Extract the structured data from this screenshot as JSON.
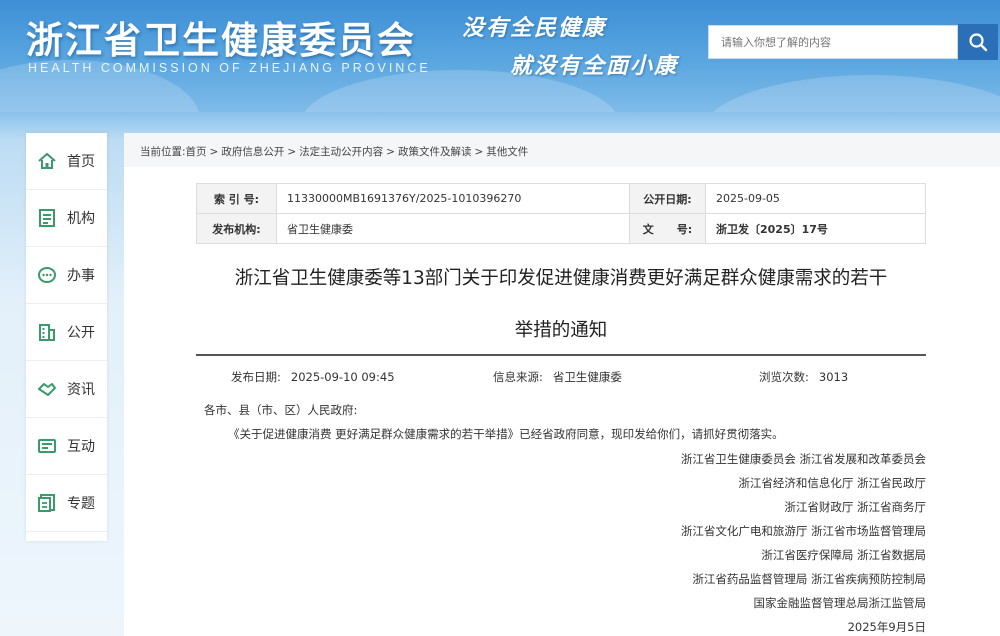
{
  "header": {
    "site_title": "浙江省卫生健康委员会",
    "site_subtitle": "HEALTH COMMISSION OF ZHEJIANG PROVINCE",
    "slogan_line1": "没有全民健康",
    "slogan_line2": "就没有全面小康",
    "search_placeholder": "请输入你想了解的内容",
    "search_icon": "search-icon"
  },
  "sidebar": {
    "items": [
      {
        "label": "首页",
        "icon": "home-icon"
      },
      {
        "label": "机构",
        "icon": "organization-icon"
      },
      {
        "label": "办事",
        "icon": "chat-icon"
      },
      {
        "label": "公开",
        "icon": "building-icon"
      },
      {
        "label": "资讯",
        "icon": "handshake-icon"
      },
      {
        "label": "互动",
        "icon": "interaction-icon"
      },
      {
        "label": "专题",
        "icon": "topic-icon"
      }
    ]
  },
  "breadcrumb": {
    "prefix": "当前位置:",
    "items": [
      "首页",
      "政府信息公开",
      "法定主动公开内容",
      "政策文件及解读",
      "其他文件"
    ]
  },
  "meta": {
    "index_label": "索 引 号:",
    "index_value": "11330000MB1691376Y/2025-1010396270",
    "date_label": "公开日期:",
    "date_value": "2025-09-05",
    "org_label": "发布机构:",
    "org_value": "省卫生健康委",
    "docno_label": "文      号:",
    "docno_value": "浙卫发〔2025〕17号"
  },
  "document": {
    "title_line1": "浙江省卫生健康委等13部门关于印发促进健康消费更好满足群众健康需求的若干",
    "title_line2": "举措的通知",
    "publish_label": "发布日期:",
    "publish_value": "2025-09-10 09:45",
    "source_label": "信息来源:",
    "source_value": "省卫生健康委",
    "views_label": "浏览次数:",
    "views_value": "3013",
    "salutation": "各市、县（市、区）人民政府:",
    "paragraph": "《关于促进健康消费 更好满足群众健康需求的若干举措》已经省政府同意，现印发给你们，请抓好贯彻落实。",
    "signers": [
      "浙江省卫生健康委员会 浙江省发展和改革委员会",
      "浙江省经济和信息化厅  浙江省民政厅",
      "浙江省财政厅  浙江省商务厅",
      "浙江省文化广电和旅游厅  浙江省市场监督管理局",
      "浙江省医疗保障局  浙江省数据局",
      "浙江省药品监督管理局  浙江省疾病预防控制局",
      "国家金融监督管理总局浙江监管局",
      "2025年9月5日"
    ]
  },
  "colors": {
    "header_blue": "#3d8fd6",
    "search_button": "#2a6fb8",
    "icon_green": "#3a9a6a"
  }
}
